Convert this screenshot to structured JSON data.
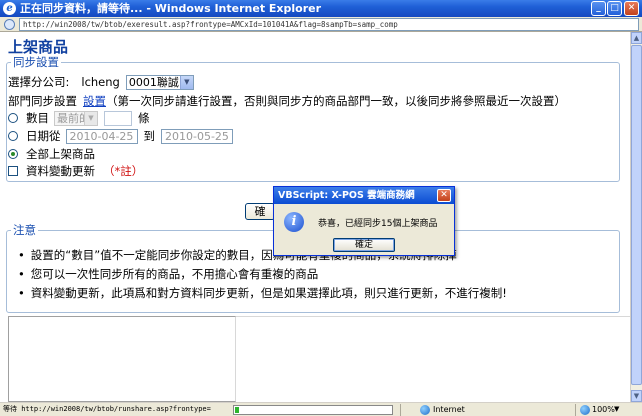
{
  "window": {
    "title": "正在同步資料，請等待... - Windows Internet Explorer",
    "url": "http://win2008/tw/btob/exeresult.asp?frontype=AMCxId=101041A&flag=8sampTb=samp_comp"
  },
  "page": {
    "title": "上架商品",
    "sync_section": {
      "legend": "同步設置",
      "company_label": "選擇分公司:",
      "company_user": "lcheng",
      "company_select": "0001聯誠",
      "dept_label": "部門同步設置",
      "dept_link": "設置",
      "dept_note": "（第一次同步請進行設置，否則與同步方的商品部門一致，以後同步將參照最近一次設置）",
      "opt_count_label": "數目",
      "opt_count_select": "最前的",
      "opt_count_suffix": "條",
      "opt_date_label": "日期從",
      "date_from": "2010-04-25",
      "date_to_label": "到",
      "date_to": "2010-05-25",
      "opt_all_label": "全部上架商品",
      "opt_changes_label": "資料變動更新",
      "opt_changes_note": "（*註）"
    },
    "submit_label": "確",
    "notes_section": {
      "legend": "注意",
      "items": [
        "設置的“數目”值不一定能同步你設定的數目，因為可能有重複的商品，系統將排除掉",
        "您可以一次性同步所有的商品，不用擔心會有重複的商品",
        "資料變動更新，此項爲和對方資料同步更新，但是如果選擇此項，則只進行更新，不進行複制!"
      ]
    }
  },
  "dialog": {
    "title": "VBScript: X-POS 雲端商務網",
    "message": "恭喜，已經同步15個上架商品",
    "ok_label": "確定"
  },
  "statusbar": {
    "text": "等待 http://win2008/tw/btob/runshare.asp?frontype=",
    "progress": 0.02,
    "zone": "Internet",
    "zoom": "100%"
  }
}
